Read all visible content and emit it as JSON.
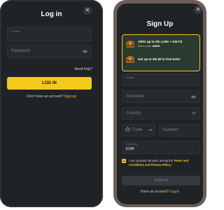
{
  "login": {
    "title": "Log in",
    "email_label": "E-mail",
    "password_placeholder": "Password",
    "need_help": "Need help?",
    "login_button": "LOG IN",
    "no_account": "Don't have an account?",
    "signup_link": "Sign up",
    "close_icon": "✕"
  },
  "signup": {
    "title": "Sign Up",
    "close_icon": "✕",
    "promo": [
      {
        "main": "100% up to €/£ 1,000 + 100 FS",
        "sub_label": "Bonus code:",
        "sub_code": "AMON"
      },
      {
        "main": "Get up to €/£ 60 in free bets!"
      }
    ],
    "email_label": "E-mail",
    "password_placeholder": "Password",
    "country_placeholder": "Country",
    "code_placeholder": "Code",
    "number_placeholder": "Number",
    "currency_label": "Currency",
    "currency_value": "EUR",
    "terms_prefix": "I am 18 years old and I accept the",
    "terms_link": "Terms and Conditions and Privacy Policy",
    "terms_suffix": "*",
    "signup_button": "SIGN UP",
    "have_account": "Have an account?",
    "login_link": "Log in"
  },
  "colors": {
    "accent": "#f3c91c",
    "background": "#202326",
    "field": "#26292d"
  },
  "icons": [
    "close-icon",
    "eye-icon",
    "chevron-down-icon",
    "star-icon",
    "treasure-chest-icon",
    "checkmark-icon"
  ]
}
